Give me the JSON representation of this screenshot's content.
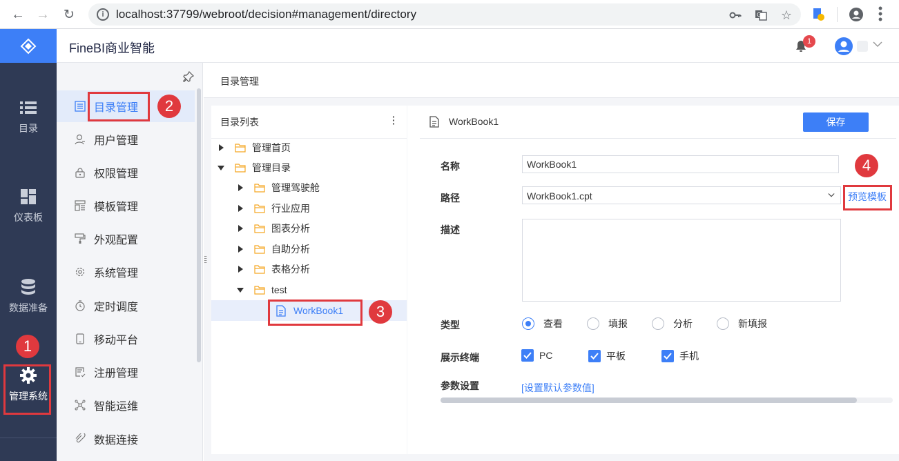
{
  "browser": {
    "url": "localhost:37799/webroot/decision#management/directory"
  },
  "header": {
    "app_title": "FineBI商业智能",
    "notification_count": "1"
  },
  "rail": {
    "items": [
      {
        "label": "目录",
        "icon": "list-icon"
      },
      {
        "label": "仪表板",
        "icon": "dashboard-icon"
      },
      {
        "label": "数据准备",
        "icon": "database-icon"
      },
      {
        "label": "管理系统",
        "icon": "gear-icon"
      }
    ]
  },
  "sidebar": {
    "items": [
      {
        "label": "目录管理",
        "icon": "directory-icon"
      },
      {
        "label": "用户管理",
        "icon": "user-icon"
      },
      {
        "label": "权限管理",
        "icon": "lock-icon"
      },
      {
        "label": "模板管理",
        "icon": "template-icon"
      },
      {
        "label": "外观配置",
        "icon": "paint-roller-icon"
      },
      {
        "label": "系统管理",
        "icon": "settings-icon"
      },
      {
        "label": "定时调度",
        "icon": "timer-icon"
      },
      {
        "label": "移动平台",
        "icon": "mobile-icon"
      },
      {
        "label": "注册管理",
        "icon": "register-icon"
      },
      {
        "label": "智能运维",
        "icon": "network-icon"
      },
      {
        "label": "数据连接",
        "icon": "link-icon"
      }
    ]
  },
  "breadcrumb": "目录管理",
  "tree": {
    "title": "目录列表",
    "rows": [
      {
        "label": "管理首页"
      },
      {
        "label": "管理目录"
      },
      {
        "label": "管理驾驶舱"
      },
      {
        "label": "行业应用"
      },
      {
        "label": "图表分析"
      },
      {
        "label": "自助分析"
      },
      {
        "label": "表格分析"
      },
      {
        "label": "test"
      },
      {
        "label": "WorkBook1"
      }
    ]
  },
  "detail": {
    "title": "WorkBook1",
    "save_label": "保存",
    "name_label": "名称",
    "name_value": "WorkBook1",
    "path_label": "路径",
    "path_value": "WorkBook1.cpt",
    "preview_label": "预览模板",
    "desc_label": "描述",
    "type_label": "类型",
    "type_options": [
      "查看",
      "填报",
      "分析",
      "新填报"
    ],
    "type_selected": "查看",
    "terminal_label": "展示终端",
    "terminals": [
      "PC",
      "平板",
      "手机"
    ],
    "param_label": "参数设置",
    "param_link": "[设置默认参数值]"
  },
  "annotations": [
    "1",
    "2",
    "3",
    "4"
  ],
  "colors": {
    "accent": "#3d7ff7",
    "rail_bg": "#2f3a55",
    "annotation_red": "#e0393e"
  }
}
